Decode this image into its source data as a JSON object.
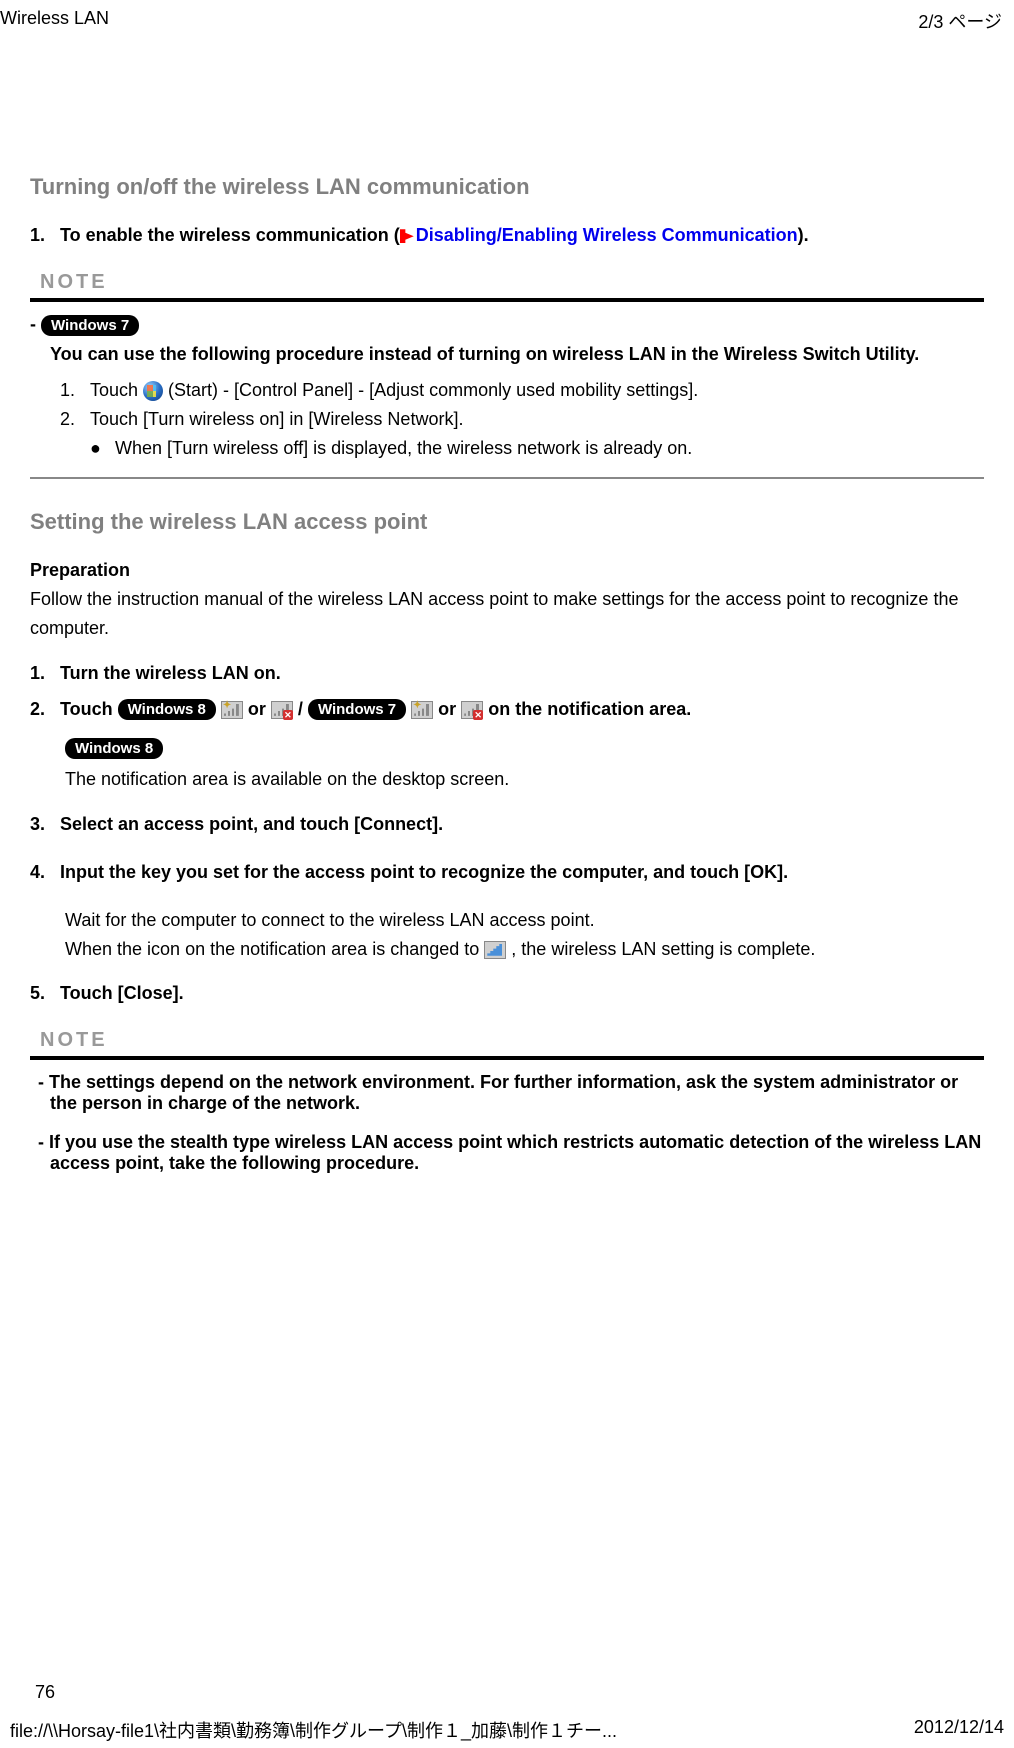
{
  "header": {
    "left": "Wireless LAN",
    "right": "2/3 ページ"
  },
  "section1": {
    "title": "Turning on/off the wireless LAN communication",
    "step1_prefix": "To enable the wireless communication (",
    "step1_link": "Disabling/Enabling Wireless Communication",
    "step1_suffix": ").",
    "note_label": "NOTE",
    "win7_badge": "Windows 7",
    "note_text": "You can use the following procedure instead of turning on wireless LAN in the Wireless Switch Utility.",
    "sub1_a": "Touch ",
    "sub1_b": " (Start) - [Control Panel] - [Adjust commonly used mobility settings].",
    "sub2": "Touch [Turn wireless on] in [Wireless Network].",
    "bullet": "When [Turn wireless off] is displayed, the wireless network is already on."
  },
  "section2": {
    "title": "Setting the wireless LAN access point",
    "prep_label": "Preparation",
    "prep_text": "Follow the instruction manual of the wireless LAN access point to make settings for the access point to recognize the computer.",
    "step1": "Turn the wireless LAN on.",
    "step2_a": "Touch ",
    "win8_badge": "Windows 8",
    "step2_b": " or ",
    "step2_c": " / ",
    "win7_badge": "Windows 7",
    "step2_d": " or ",
    "step2_e": " on the notification area.",
    "step2_sub": "The notification area is available on the desktop screen.",
    "step3": "Select an access point, and touch [Connect].",
    "step4": "Input the key you set for the access point to recognize the computer, and touch [OK].",
    "step4_sub1": "Wait for the computer to connect to the wireless LAN access point.",
    "step4_sub2a": "When the icon on the notification area is changed to ",
    "step4_sub2b": ", the wireless LAN setting is complete.",
    "step5": "Touch [Close].",
    "note2_label": "NOTE",
    "note2_1": "- The settings depend on the network environment. For further information, ask the system administrator or the person in charge of the network.",
    "note2_2": "- If you use the stealth type wireless LAN access point which restricts automatic detection of the wireless LAN access point, take the following procedure."
  },
  "page_number": "76",
  "footer": {
    "left": "file://\\\\Horsay-file1\\社内書類\\勤務簿\\制作グループ\\制作１_加藤\\制作１チー...",
    "right": "2012/12/14"
  }
}
